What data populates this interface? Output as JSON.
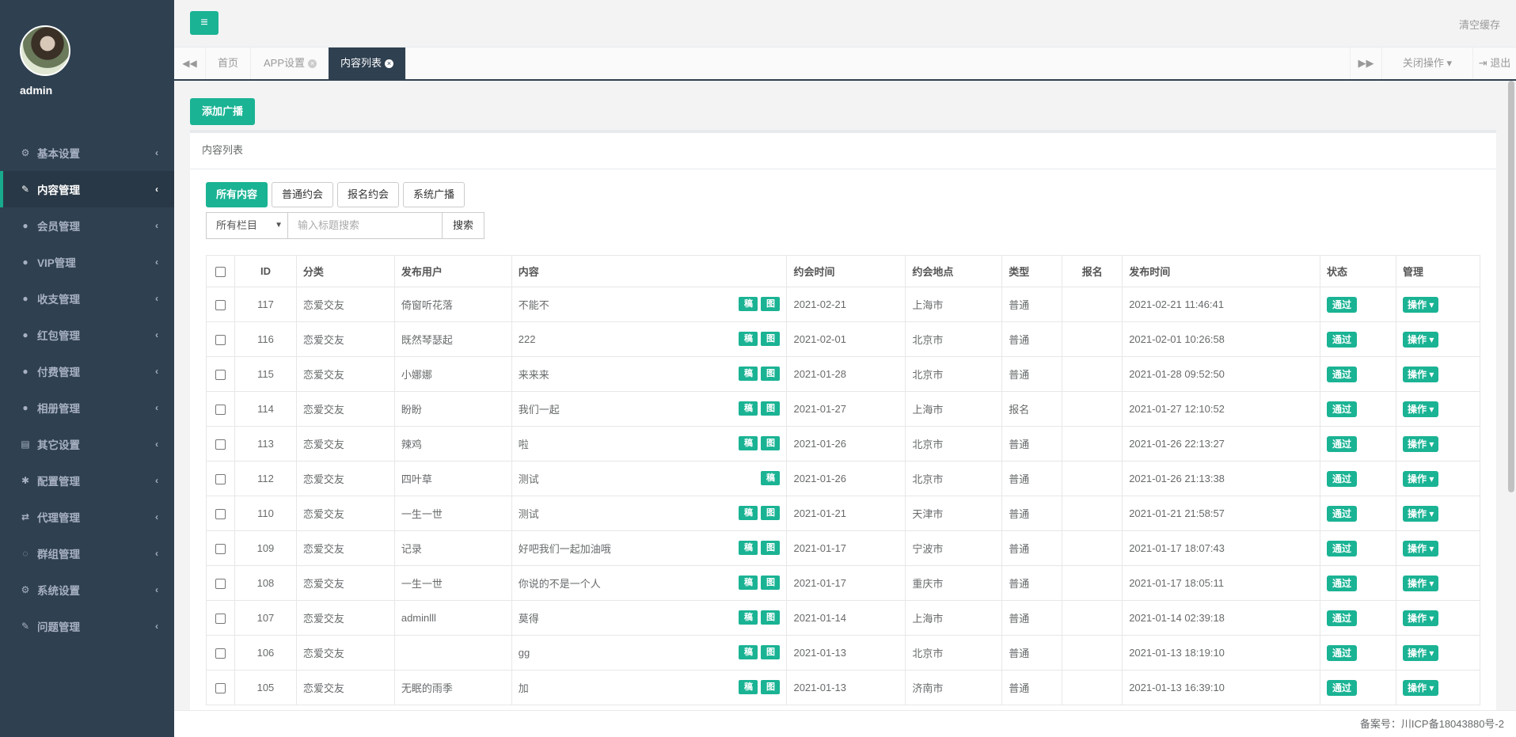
{
  "profile": {
    "name": "admin"
  },
  "sidebar": {
    "items": [
      {
        "label": "基本设置",
        "icon": "⚙",
        "active": false
      },
      {
        "label": "内容管理",
        "icon": "✎",
        "active": true
      },
      {
        "label": "会员管理",
        "icon": "●",
        "active": false
      },
      {
        "label": "VIP管理",
        "icon": "●",
        "active": false
      },
      {
        "label": "收支管理",
        "icon": "●",
        "active": false
      },
      {
        "label": "红包管理",
        "icon": "●",
        "active": false
      },
      {
        "label": "付费管理",
        "icon": "●",
        "active": false
      },
      {
        "label": "相册管理",
        "icon": "●",
        "active": false
      },
      {
        "label": "其它设置",
        "icon": "▤",
        "active": false
      },
      {
        "label": "配置管理",
        "icon": "✱",
        "active": false
      },
      {
        "label": "代理管理",
        "icon": "⇄",
        "active": false
      },
      {
        "label": "群组管理",
        "icon": "◌",
        "active": false
      },
      {
        "label": "系统设置",
        "icon": "⚙",
        "active": false
      },
      {
        "label": "问题管理",
        "icon": "✎",
        "active": false
      }
    ]
  },
  "topbar": {
    "clear_cache": "清空缓存",
    "menu_icon": "≡"
  },
  "tabs": {
    "items": [
      "首页",
      "APP设置",
      "内容列表"
    ],
    "close_ops": "关闭操作",
    "logout": "退出"
  },
  "content": {
    "add_button": "添加广播",
    "panel_title": "内容列表",
    "filters": [
      "所有内容",
      "普通约会",
      "报名约会",
      "系统广播"
    ],
    "select_value": "所有栏目",
    "search_placeholder": "输入标题搜索",
    "search_button": "搜索"
  },
  "table": {
    "headers": [
      "ID",
      "分类",
      "发布用户",
      "内容",
      "约会时间",
      "约会地点",
      "类型",
      "报名",
      "发布时间",
      "状态",
      "管理"
    ],
    "badge_a": "稿",
    "badge_b": "图",
    "status_label": "通过",
    "op_label": "操作",
    "rows": [
      {
        "id": "117",
        "cat": "恋爱交友",
        "user": "倚窗听花落",
        "content": "不能不",
        "badges": 2,
        "date": "2021-02-21",
        "place": "上海市",
        "type": "普通",
        "signup": "",
        "pub": "2021-02-21 11:46:41"
      },
      {
        "id": "116",
        "cat": "恋爱交友",
        "user": "既然琴瑟起",
        "content": "222",
        "badges": 2,
        "date": "2021-02-01",
        "place": "北京市",
        "type": "普通",
        "signup": "",
        "pub": "2021-02-01 10:26:58"
      },
      {
        "id": "115",
        "cat": "恋爱交友",
        "user": "小娜娜",
        "content": "来来来",
        "badges": 2,
        "date": "2021-01-28",
        "place": "北京市",
        "type": "普通",
        "signup": "",
        "pub": "2021-01-28 09:52:50"
      },
      {
        "id": "114",
        "cat": "恋爱交友",
        "user": "盼盼",
        "content": "我们一起",
        "badges": 2,
        "date": "2021-01-27",
        "place": "上海市",
        "type": "报名",
        "signup": "",
        "pub": "2021-01-27 12:10:52"
      },
      {
        "id": "113",
        "cat": "恋爱交友",
        "user": "辣鸡",
        "content": "啦",
        "badges": 2,
        "date": "2021-01-26",
        "place": "北京市",
        "type": "普通",
        "signup": "",
        "pub": "2021-01-26 22:13:27"
      },
      {
        "id": "112",
        "cat": "恋爱交友",
        "user": "四叶草",
        "content": "测试",
        "badges": 1,
        "date": "2021-01-26",
        "place": "北京市",
        "type": "普通",
        "signup": "",
        "pub": "2021-01-26 21:13:38"
      },
      {
        "id": "110",
        "cat": "恋爱交友",
        "user": "一生一世",
        "content": "测试",
        "badges": 2,
        "date": "2021-01-21",
        "place": "天津市",
        "type": "普通",
        "signup": "",
        "pub": "2021-01-21 21:58:57"
      },
      {
        "id": "109",
        "cat": "恋爱交友",
        "user": "记录",
        "content": "好吧我们一起加油哦",
        "badges": 2,
        "date": "2021-01-17",
        "place": "宁波市",
        "type": "普通",
        "signup": "",
        "pub": "2021-01-17 18:07:43"
      },
      {
        "id": "108",
        "cat": "恋爱交友",
        "user": "一生一世",
        "content": "你说的不是一个人",
        "badges": 2,
        "date": "2021-01-17",
        "place": "重庆市",
        "type": "普通",
        "signup": "",
        "pub": "2021-01-17 18:05:11"
      },
      {
        "id": "107",
        "cat": "恋爱交友",
        "user": "adminlll",
        "content": "莫得",
        "badges": 2,
        "date": "2021-01-14",
        "place": "上海市",
        "type": "普通",
        "signup": "",
        "pub": "2021-01-14 02:39:18"
      },
      {
        "id": "106",
        "cat": "恋爱交友",
        "user": "",
        "content": "gg",
        "badges": 2,
        "date": "2021-01-13",
        "place": "北京市",
        "type": "普通",
        "signup": "",
        "pub": "2021-01-13 18:19:10"
      },
      {
        "id": "105",
        "cat": "恋爱交友",
        "user": "无眠的雨季",
        "content": "加",
        "badges": 2,
        "date": "2021-01-13",
        "place": "济南市",
        "type": "普通",
        "signup": "",
        "pub": "2021-01-13 16:39:10"
      }
    ]
  },
  "footer": {
    "text": "备案号：川ICP备18043880号-2"
  }
}
